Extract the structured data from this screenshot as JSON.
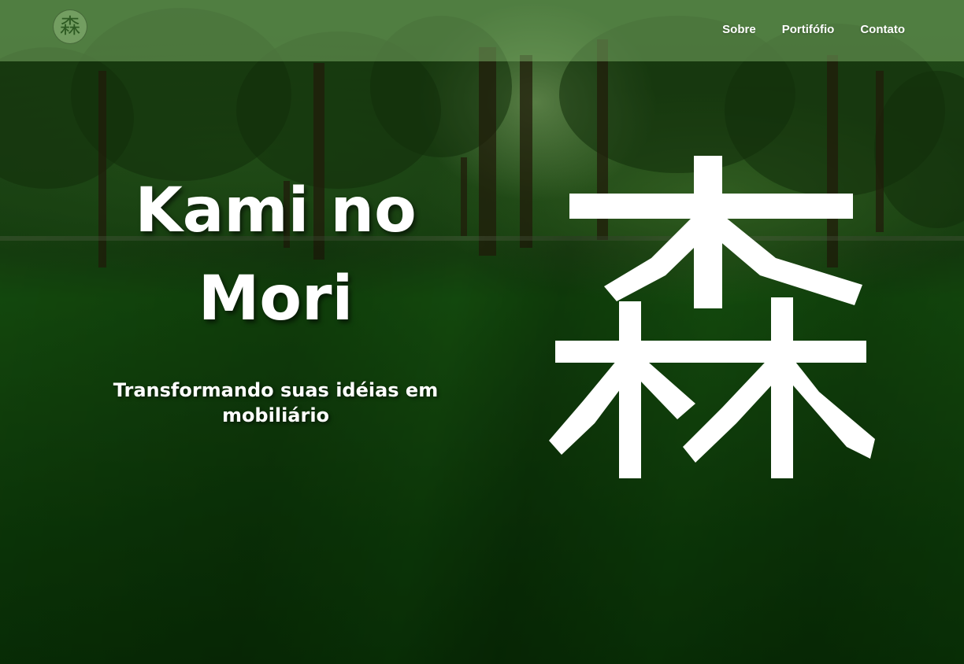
{
  "logo": {
    "icon": "forest-kanji-icon",
    "glyph": "森"
  },
  "nav": {
    "items": [
      {
        "label": "Sobre"
      },
      {
        "label": "Portifófio"
      },
      {
        "label": "Contato"
      }
    ]
  },
  "hero": {
    "title": "Kami no Mori",
    "subtitle": "Transformando suas idéias em mobiliário",
    "kanji": "森"
  },
  "colors": {
    "navbar": "#78aa64",
    "text": "#ffffff",
    "forest_dark": "#0f3a0c",
    "forest_light": "#2f5f22"
  }
}
